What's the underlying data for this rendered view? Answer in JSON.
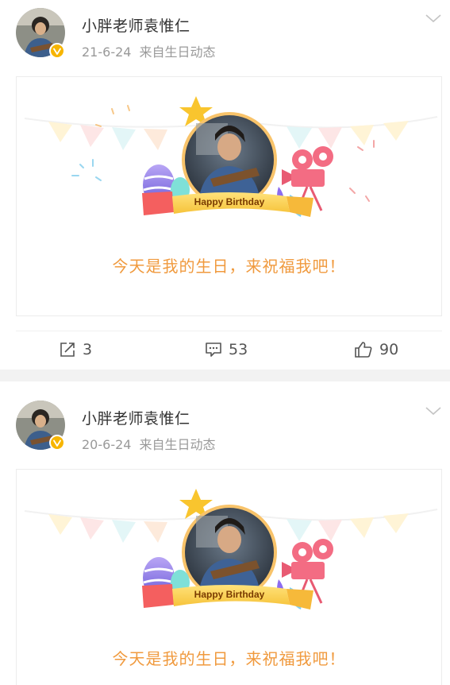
{
  "posts": [
    {
      "author": "小胖老师袁惟仁",
      "date": "21-6-24",
      "source": "来自生日动态",
      "card_banner": "Happy Birthday",
      "card_text": "今天是我的生日，来祝福我吧！",
      "reposts": "3",
      "comments": "53",
      "likes": "90"
    },
    {
      "author": "小胖老师袁惟仁",
      "date": "20-6-24",
      "source": "来自生日动态",
      "card_banner": "Happy Birthday",
      "card_text": "今天是我的生日，来祝福我吧！"
    }
  ],
  "colors": {
    "accent_text": "#f09a3e",
    "verified_badge": "#f7b500",
    "separator": "#f2f2f2"
  },
  "icons": {
    "badge": "verified-v-icon",
    "chevron": "chevron-down-icon",
    "repost": "share-icon",
    "comment": "comment-icon",
    "like": "thumbs-up-icon"
  }
}
